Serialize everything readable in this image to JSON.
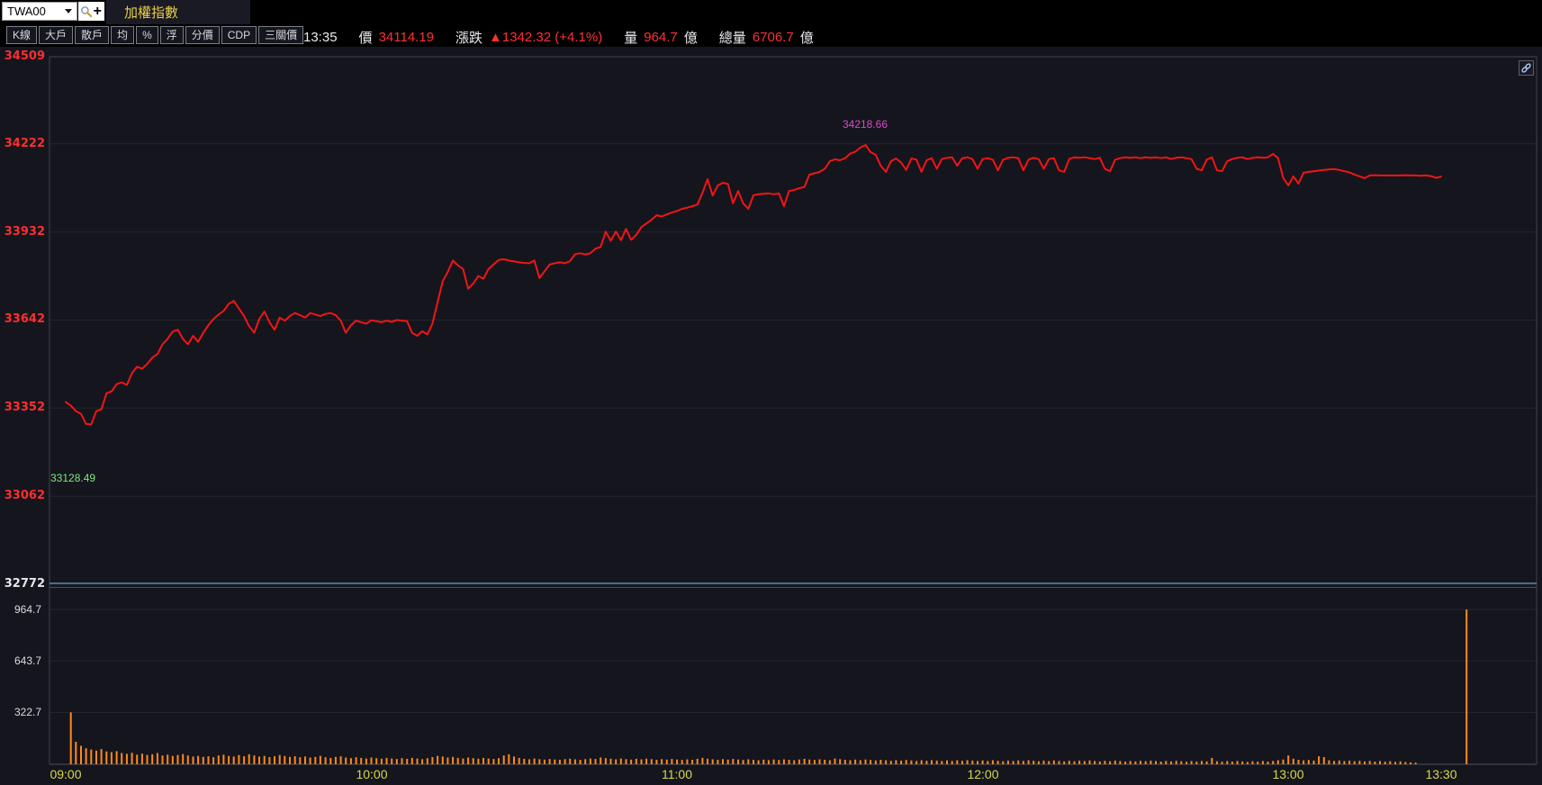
{
  "topbar": {
    "symbol_input": {
      "value": "TWA00"
    },
    "add_button": "+",
    "tab": "加權指數"
  },
  "toolbar": {
    "buttons": [
      "K線",
      "大戶",
      "散戶",
      "均",
      "%",
      "浮",
      "分價",
      "CDP",
      "三關價"
    ]
  },
  "status": {
    "time": "13:35",
    "price_label": "價",
    "price_value": "34114.19",
    "change_label": "漲跌",
    "change_value": "▲1342.32 (+4.1%)",
    "volume_label": "量",
    "volume_value": "964.7",
    "volume_unit": "億",
    "total_label": "總量",
    "total_value": "6706.7",
    "total_unit": "億"
  },
  "colors": {
    "background": "#15151e",
    "topbar_bg": "#000000",
    "axis_red": "#ff2e2e",
    "line_red": "#f21515",
    "bar_orange": "#ff8a1a",
    "time_yellow": "#d8d848",
    "high_magenta": "#e048c8",
    "low_green": "#7de87d",
    "tab_yellow": "#e8cf4a",
    "grid": "rgba(255,255,255,0.07)",
    "border": "#3e4450",
    "separator_teal": "#46707c"
  },
  "chart_data": {
    "type": "line",
    "title": "加權指數 intraday 1-minute price with volume",
    "legend": "none",
    "grid": "horizontal-only",
    "x_axis": {
      "labels": [
        "09:00",
        "10:00",
        "11:00",
        "12:00",
        "13:00",
        "13:30"
      ],
      "minutes": [
        0,
        60,
        120,
        180,
        240,
        270
      ]
    },
    "price_axis": {
      "ticks": [
        34509,
        34222,
        33932,
        33642,
        33352,
        33062,
        32772
      ],
      "range": [
        32772,
        34509
      ]
    },
    "volume_axis": {
      "ticks": [
        964.7,
        643.7,
        322.7
      ],
      "range": [
        0,
        1100
      ]
    },
    "annotations": {
      "high": {
        "value": "34218.66",
        "minute": 157
      },
      "low": {
        "value": "33128.49",
        "price": 33128.49
      }
    },
    "price_minutes": [
      33372,
      33360,
      33342,
      33333,
      33300,
      33298,
      33342,
      33348,
      33401,
      33407,
      33431,
      33437,
      33428,
      33467,
      33488,
      33482,
      33497,
      33518,
      33530,
      33562,
      33580,
      33604,
      33610,
      33580,
      33562,
      33590,
      33570,
      33600,
      33625,
      33645,
      33660,
      33672,
      33695,
      33705,
      33680,
      33655,
      33622,
      33600,
      33645,
      33670,
      33635,
      33610,
      33650,
      33640,
      33655,
      33665,
      33658,
      33650,
      33665,
      33660,
      33655,
      33662,
      33665,
      33658,
      33640,
      33600,
      33625,
      33640,
      33635,
      33630,
      33641,
      33638,
      33635,
      33640,
      33636,
      33642,
      33640,
      33638,
      33600,
      33590,
      33605,
      33595,
      33630,
      33700,
      33770,
      33800,
      33838,
      33822,
      33810,
      33745,
      33762,
      33787,
      33778,
      33810,
      33825,
      33840,
      33842,
      33838,
      33835,
      33832,
      33830,
      33829,
      33838,
      33780,
      33802,
      33825,
      33829,
      33832,
      33829,
      33836,
      33859,
      33862,
      33858,
      33862,
      33877,
      33882,
      33933,
      33903,
      33933,
      33905,
      33942,
      33906,
      33922,
      33948,
      33960,
      33972,
      33987,
      33983,
      33990,
      33996,
      34001,
      34008,
      34012,
      34017,
      34022,
      34061,
      34106,
      34052,
      34085,
      34094,
      34090,
      34026,
      34067,
      34026,
      34008,
      34053,
      34056,
      34058,
      34059,
      34056,
      34059,
      34017,
      34067,
      34070,
      34076,
      34080,
      34121,
      34125,
      34130,
      34140,
      34165,
      34171,
      34168,
      34175,
      34190,
      34196,
      34210,
      34218.66,
      34195,
      34186,
      34150,
      34130,
      34165,
      34174,
      34160,
      34136,
      34174,
      34170,
      34130,
      34168,
      34175,
      34140,
      34172,
      34176,
      34178,
      34150,
      34175,
      34178,
      34172,
      34140,
      34172,
      34175,
      34170,
      34135,
      34170,
      34176,
      34178,
      34175,
      34135,
      34170,
      34176,
      34172,
      34140,
      34172,
      34175,
      34135,
      34130,
      34172,
      34178,
      34176,
      34178,
      34175,
      34172,
      34176,
      34140,
      34132,
      34170,
      34175,
      34178,
      34176,
      34178,
      34175,
      34178,
      34176,
      34178,
      34175,
      34178,
      34172,
      34176,
      34178,
      34175,
      34172,
      34140,
      34135,
      34170,
      34178,
      34135,
      34132,
      34165,
      34172,
      34176,
      34178,
      34172,
      34176,
      34178,
      34176,
      34178,
      34189,
      34175,
      34110,
      34085,
      34115,
      34091,
      34127,
      34130,
      34132,
      34134,
      34136,
      34138,
      34139,
      34136,
      34132,
      34128,
      34121,
      34115,
      34109,
      34118,
      34119,
      34118,
      34118,
      34118,
      34118,
      34118,
      34119,
      34118,
      34118,
      34117,
      34118,
      34116,
      34110,
      34114.19
    ],
    "volume_minutes": [
      0,
      323,
      140,
      115,
      100,
      92,
      85,
      95,
      80,
      75,
      82,
      70,
      65,
      72,
      60,
      66,
      58,
      62,
      70,
      55,
      60,
      52,
      58,
      64,
      55,
      48,
      52,
      46,
      50,
      44,
      55,
      60,
      52,
      48,
      58,
      50,
      62,
      55,
      48,
      52,
      45,
      50,
      58,
      52,
      46,
      50,
      44,
      48,
      42,
      46,
      52,
      44,
      40,
      46,
      50,
      42,
      38,
      44,
      40,
      36,
      42,
      38,
      35,
      40,
      36,
      33,
      38,
      34,
      40,
      36,
      32,
      38,
      45,
      52,
      48,
      42,
      46,
      40,
      36,
      42,
      38,
      35,
      40,
      36,
      33,
      38,
      55,
      62,
      48,
      40,
      34,
      31,
      36,
      32,
      29,
      33,
      30,
      28,
      32,
      35,
      31,
      28,
      32,
      36,
      33,
      42,
      38,
      35,
      31,
      36,
      32,
      29,
      34,
      31,
      35,
      32,
      28,
      32,
      29,
      33,
      30,
      27,
      31,
      28,
      34,
      40,
      35,
      31,
      28,
      32,
      29,
      33,
      30,
      27,
      31,
      28,
      25,
      29,
      26,
      30,
      27,
      31,
      28,
      25,
      30,
      34,
      30,
      27,
      31,
      28,
      25,
      36,
      32,
      28,
      25,
      29,
      26,
      30,
      27,
      24,
      28,
      25,
      22,
      26,
      23,
      27,
      24,
      21,
      25,
      22,
      26,
      23,
      20,
      24,
      21,
      25,
      22,
      26,
      23,
      20,
      24,
      21,
      25,
      22,
      19,
      23,
      20,
      24,
      21,
      25,
      22,
      19,
      23,
      20,
      24,
      21,
      18,
      22,
      19,
      23,
      20,
      24,
      21,
      18,
      22,
      19,
      23,
      20,
      17,
      21,
      18,
      22,
      19,
      23,
      20,
      17,
      21,
      18,
      22,
      19,
      16,
      20,
      17,
      21,
      18,
      40,
      19,
      16,
      20,
      17,
      21,
      18,
      15,
      19,
      16,
      20,
      17,
      21,
      25,
      30,
      55,
      35,
      28,
      24,
      27,
      23,
      50,
      45,
      25,
      21,
      24,
      20,
      23,
      19,
      22,
      18,
      21,
      17,
      20,
      16,
      19,
      15,
      18,
      14,
      12,
      10
    ],
    "closing_volume": {
      "minute": 275,
      "value": 964.7
    }
  }
}
